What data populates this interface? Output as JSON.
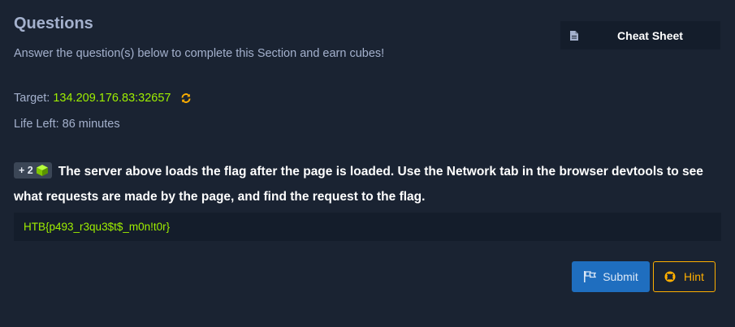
{
  "section": {
    "title": "Questions",
    "subtitle": "Answer the question(s) below to complete this Section and earn cubes!"
  },
  "cheat_sheet": {
    "label": "Cheat Sheet",
    "icon": "document-icon"
  },
  "target": {
    "label": "Target:",
    "ip": "134.209.176.83:32657",
    "refresh_icon": "refresh-icon"
  },
  "life": {
    "text": "Life Left: 86 minutes"
  },
  "question": {
    "reward": "+ 2",
    "reward_icon": "cube-icon",
    "text": "The server above loads the flag after the page is loaded. Use the Network tab in the browser devtools to see what requests are made by the page, and find the request to the flag."
  },
  "answer": {
    "value": "HTB{p493_r3qu3$t$_m0n!t0r}"
  },
  "buttons": {
    "submit_label": "Submit",
    "submit_icon": "flag-icon",
    "hint_label": "Hint",
    "hint_icon": "lifebuoy-icon"
  },
  "colors": {
    "background": "#1a2332",
    "panel": "#141d2b",
    "accent_green": "#9fef00",
    "submit_blue": "#1f6ebf",
    "hint_orange": "#ffaf00",
    "text_muted": "#a4b1cd"
  }
}
